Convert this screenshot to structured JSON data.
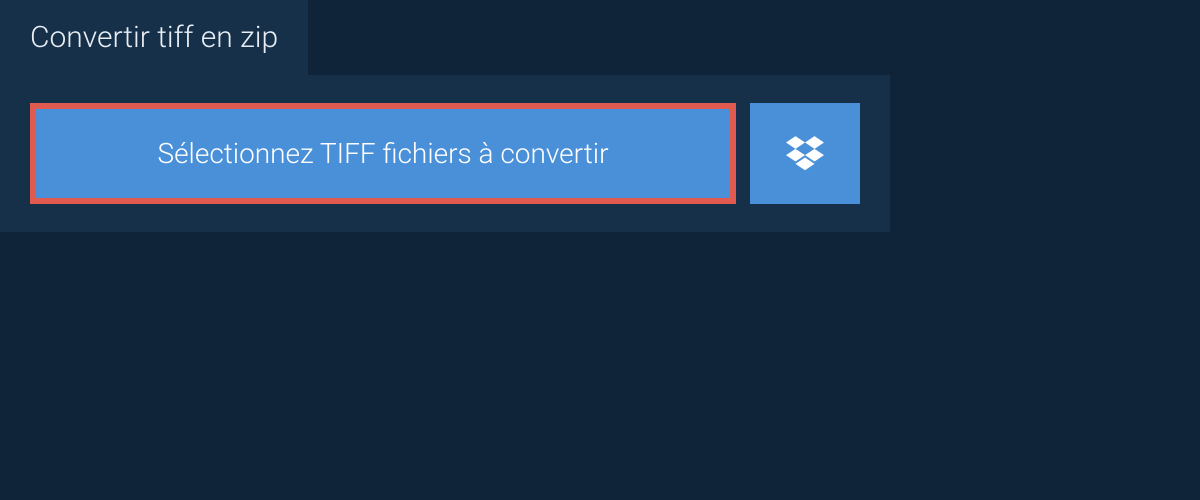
{
  "tab": {
    "title": "Convertir tiff en zip"
  },
  "actions": {
    "select_label": "Sélectionnez TIFF fichiers à convertir",
    "dropbox_icon": "dropbox"
  }
}
